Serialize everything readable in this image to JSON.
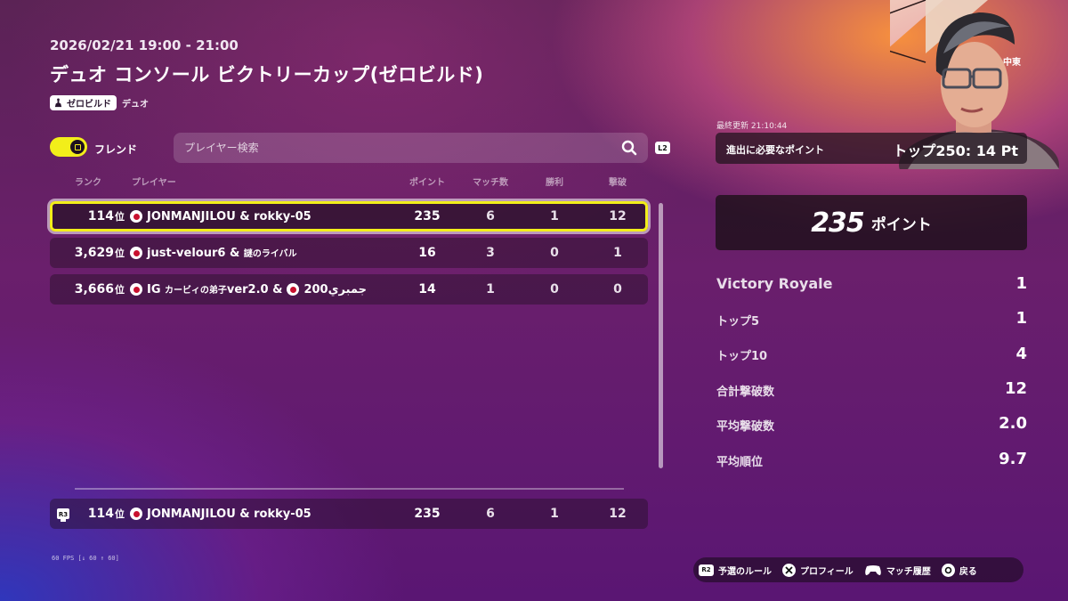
{
  "header": {
    "date": "2026/02/21 19:00 - 21:00",
    "title": "デュオ コンソール ビクトリーカップ(ゼロビルド)",
    "mode_badge": "ゼロビルド",
    "mode_text": "デュオ"
  },
  "filter": {
    "friend_label": "フレンド",
    "friend_toggle_on": true,
    "search_placeholder": "プレイヤー検索",
    "search_button_hint": "L2"
  },
  "table": {
    "columns": [
      "ランク",
      "プレイヤー",
      "ポイント",
      "マッチ数",
      "勝利",
      "撃破"
    ],
    "rows": [
      {
        "rank": "114",
        "rank_suffix": "位",
        "player": "JONMANJILOU & rokky-05",
        "points": "235",
        "matches": "6",
        "wins": "1",
        "kills": "12",
        "selected": true
      },
      {
        "rank": "3,629",
        "rank_suffix": "位",
        "player": "just-velour6 & ",
        "player_small": "謎のライバル",
        "points": "16",
        "matches": "3",
        "wins": "0",
        "kills": "1"
      },
      {
        "rank": "3,666",
        "rank_suffix": "位",
        "player": "IG ",
        "player_small": "カービィの弟子",
        "player_tail": "ver2.0 & ",
        "player2": "200جمبري",
        "points": "14",
        "matches": "1",
        "wins": "0",
        "kills": "0"
      }
    ],
    "self_row": {
      "button_hint": "R3",
      "rank": "114",
      "rank_suffix": "位",
      "player": "JONMANJILOU & rokky-05",
      "points": "235",
      "matches": "6",
      "wins": "1",
      "kills": "12"
    }
  },
  "fps": "60 FPS [↓ 60 ↑ 60]",
  "side": {
    "region": "中東",
    "updated": "最終更新 21:10:44",
    "qualify_label": "進出に必要なポイント",
    "qualify_value": "トップ250: 14 Pt",
    "total_points": "235",
    "total_label": "ポイント",
    "stats": [
      {
        "label": "Victory Royale",
        "value": "1"
      },
      {
        "label": "トップ5",
        "value": "1"
      },
      {
        "label": "トップ10",
        "value": "4"
      },
      {
        "label": "合計撃破数",
        "value": "12"
      },
      {
        "label": "平均撃破数",
        "value": "2.0"
      },
      {
        "label": "平均順位",
        "value": "9.7"
      }
    ]
  },
  "hints": [
    {
      "button": "R2",
      "label": "予選のルール"
    },
    {
      "button": "cross-icon",
      "label": "プロフィール"
    },
    {
      "button": "gamepad-icon",
      "label": "マッチ履歴"
    },
    {
      "button": "circle-icon",
      "label": "戻る"
    }
  ],
  "colors": {
    "accent": "#f2ee1a",
    "flag_red": "#c8102e"
  }
}
